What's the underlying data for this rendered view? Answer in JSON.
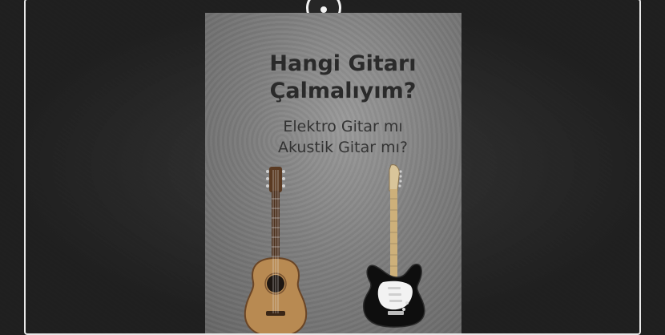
{
  "poster": {
    "title_line1": "Hangi Gitarı",
    "title_line2": "Çalmalıyım?",
    "subtitle_line1": "Elektro Gitar mı",
    "subtitle_line2": "Akustik Gitar mı?"
  },
  "icons": {
    "top": "record-circle-icon",
    "left_guitar": "acoustic-guitar-icon",
    "right_guitar": "electric-guitar-icon"
  },
  "colors": {
    "background": "#2b2b2b",
    "frame": "#e8e8e8",
    "poster": "#8a8a8a",
    "title_text": "#2a2a2a"
  }
}
